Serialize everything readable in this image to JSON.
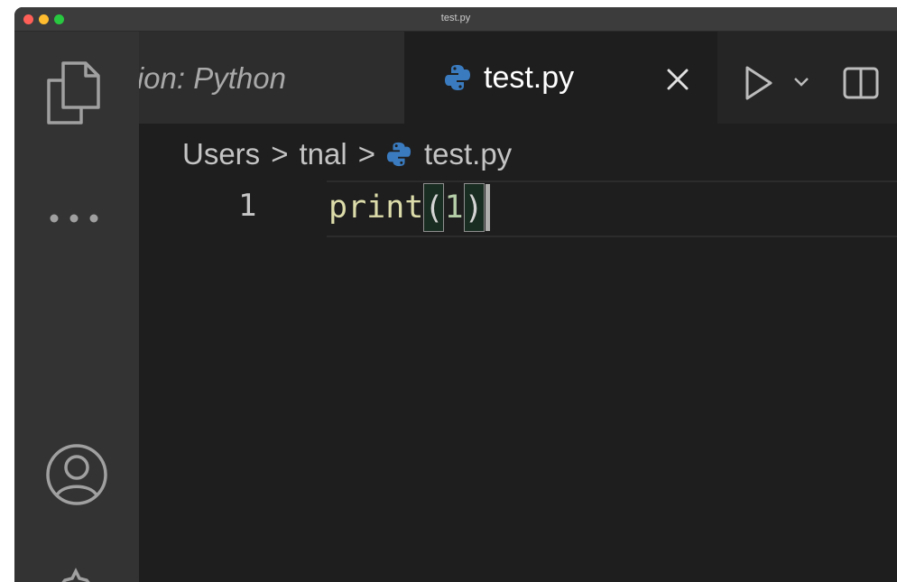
{
  "window": {
    "title": "test.py"
  },
  "activity_bar": {
    "icons": [
      "files-icon",
      "more-icon",
      "account-icon",
      "gear-icon"
    ]
  },
  "tabs": [
    {
      "label": "nsion: Python",
      "active": false
    },
    {
      "label": "test.py",
      "active": true,
      "icon": "python-icon"
    }
  ],
  "editor_actions": {
    "icons": [
      "run-icon",
      "chevron-down-icon",
      "split-editor-icon"
    ]
  },
  "breadcrumb": {
    "parts": [
      "Users",
      "tnal",
      "test.py"
    ],
    "separator": ">"
  },
  "editor": {
    "lines": [
      {
        "number": "1",
        "tokens": {
          "fn": "print",
          "open": "(",
          "num": "1",
          "close": ")"
        }
      }
    ]
  },
  "colors": {
    "editor_bg": "#1e1e1e",
    "activity_bar_bg": "#333333",
    "function": "#dcdcaa",
    "number": "#b5cea8",
    "python_blue": "#3a7bbf"
  }
}
